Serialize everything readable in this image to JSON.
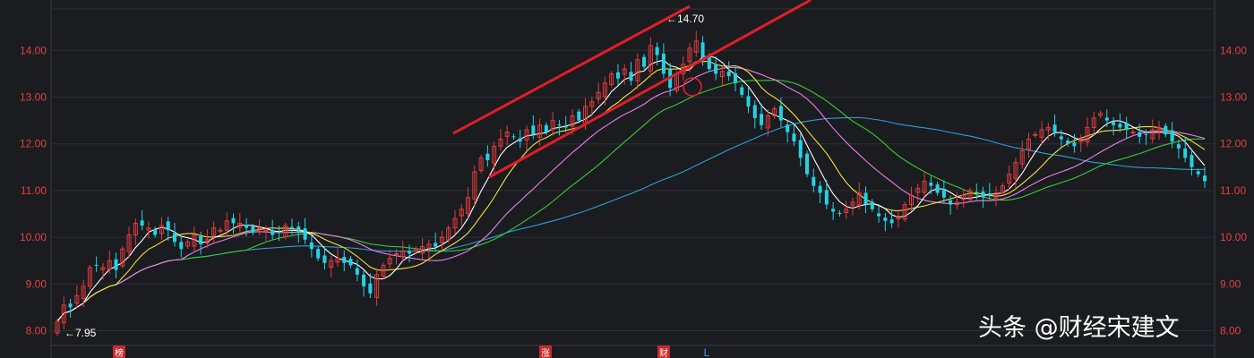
{
  "chart_data": {
    "type": "candlestick",
    "title": "",
    "xlabel": "",
    "ylabel": "",
    "ylim": [
      7.8,
      14.8
    ],
    "y_ticks": [
      "8.00",
      "9.00",
      "10.00",
      "11.00",
      "12.00",
      "13.00",
      "14.00"
    ],
    "grid": true,
    "colors": {
      "up": "#e03c3c",
      "down": "#22d3e6",
      "ma5": "#ffffff",
      "ma10": "#f2e240",
      "ma20": "#e87fe8",
      "ma30": "#33cc33",
      "ma60": "#2a9fd6",
      "trendline": "#e01e28"
    },
    "series_note": "",
    "annotations": {
      "high_label": "←14.70",
      "high_value": 14.7,
      "low_label": "←7.95",
      "low_value": 7.95
    },
    "event_markers": [
      {
        "text": "榜",
        "kind": "box"
      },
      {
        "text": "涨",
        "kind": "box"
      },
      {
        "text": "财",
        "kind": "box"
      },
      {
        "text": "L",
        "kind": "letter"
      }
    ],
    "closes": [
      8.2,
      8.55,
      8.5,
      8.75,
      8.95,
      9.35,
      9.4,
      9.35,
      9.5,
      9.3,
      9.75,
      10.05,
      10.3,
      10.25,
      10.2,
      10.05,
      10.25,
      10.15,
      9.9,
      9.75,
      9.9,
      10.05,
      9.85,
      9.95,
      10.2,
      10.15,
      10.35,
      10.3,
      10.3,
      10.2,
      10.1,
      10.2,
      10.15,
      10.05,
      10.1,
      10.25,
      10.2,
      10.1,
      9.95,
      9.75,
      9.55,
      9.45,
      9.5,
      9.55,
      9.45,
      9.4,
      9.2,
      8.95,
      8.8,
      9.2,
      9.4,
      9.55,
      9.65,
      9.7,
      9.65,
      9.75,
      9.8,
      9.85,
      9.8,
      10.0,
      10.2,
      10.4,
      10.6,
      10.85,
      11.4,
      11.7,
      11.65,
      11.95,
      12.1,
      12.25,
      12.15,
      12.05,
      12.3,
      12.2,
      12.4,
      12.25,
      12.5,
      12.4,
      12.35,
      12.6,
      12.5,
      12.8,
      12.9,
      13.1,
      13.3,
      13.5,
      13.4,
      13.6,
      13.35,
      13.8,
      13.65,
      14.1,
      13.9,
      13.5,
      13.2,
      13.5,
      13.7,
      14.05,
      14.2,
      13.85,
      13.6,
      13.5,
      13.55,
      13.45,
      13.3,
      13.05,
      12.8,
      12.55,
      12.4,
      12.6,
      12.75,
      12.5,
      12.25,
      12.05,
      11.7,
      11.35,
      11.1,
      10.95,
      10.7,
      10.55,
      10.5,
      10.6,
      10.75,
      10.95,
      10.7,
      10.6,
      10.45,
      10.35,
      10.3,
      10.45,
      10.7,
      10.9,
      11.05,
      11.2,
      11.1,
      10.95,
      10.85,
      10.7,
      10.75,
      10.9,
      11.0,
      10.95,
      10.85,
      10.9,
      10.95,
      11.1,
      11.35,
      11.6,
      11.85,
      12.1,
      12.2,
      12.3,
      12.35,
      12.25,
      12.1,
      12.0,
      11.95,
      12.1,
      12.35,
      12.55,
      12.65,
      12.5,
      12.4,
      12.35,
      12.3,
      12.25,
      12.15,
      12.2,
      12.3,
      12.35,
      12.2,
      12.05,
      11.9,
      11.7,
      11.5,
      11.35,
      11.2
    ]
  },
  "watermark": "头条 @财经宋建文"
}
